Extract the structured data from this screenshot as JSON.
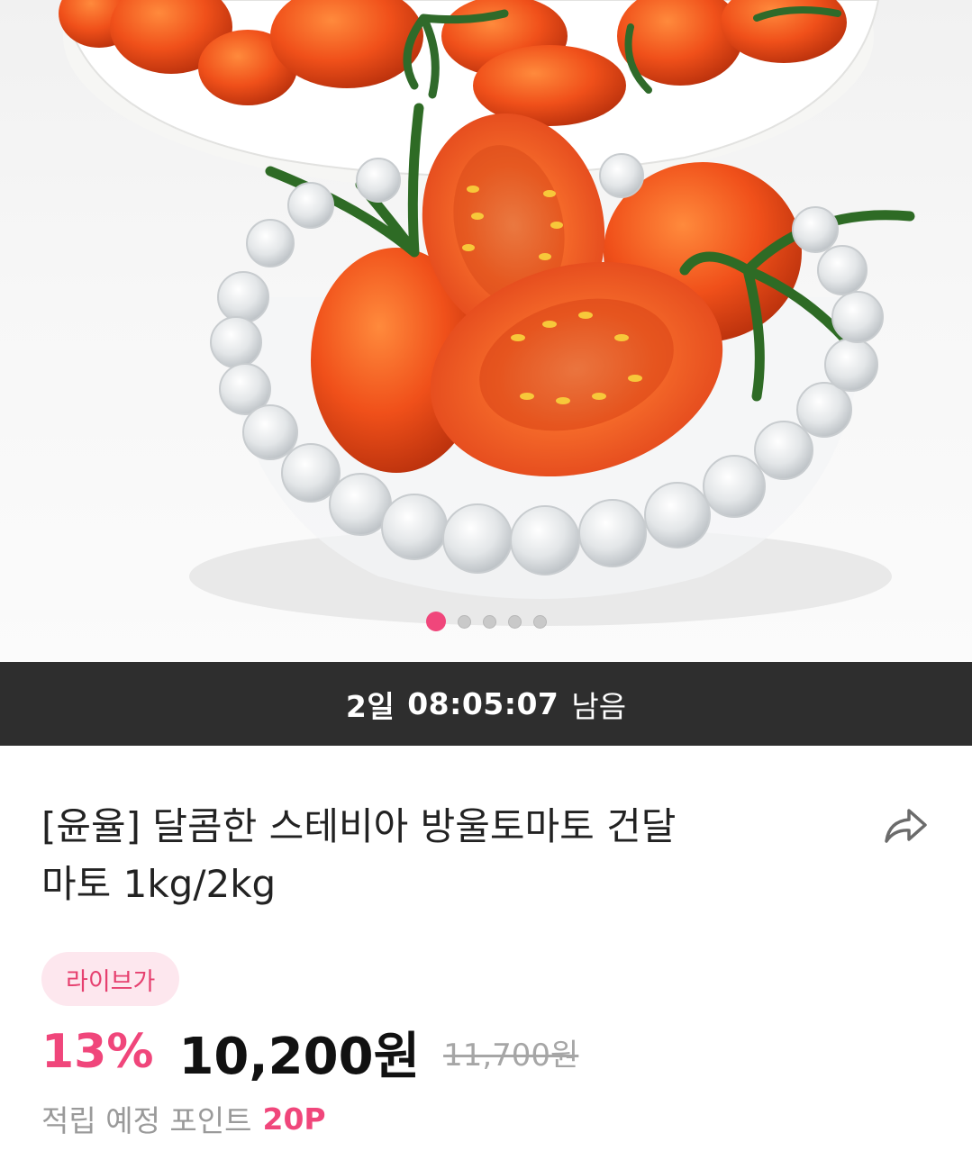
{
  "colors": {
    "accent": "#f0467b",
    "timer_bg": "#2e2e2e",
    "badge_bg": "#fde7ee"
  },
  "carousel": {
    "total": 5,
    "active_index": 0
  },
  "timer": {
    "days": "2일",
    "time": "08:05:07",
    "suffix": "남음"
  },
  "product": {
    "title_line1": "[윤율] 달콤한 스테비아 방울토마토 건달",
    "title_line2": "마토 1kg/2kg",
    "share_icon": "share-arrow-icon"
  },
  "pricing": {
    "badge": "라이브가",
    "discount": "13%",
    "price": "10,200원",
    "original_price": "11,700원"
  },
  "points": {
    "label": "적립 예정 포인트",
    "value": "20P"
  }
}
